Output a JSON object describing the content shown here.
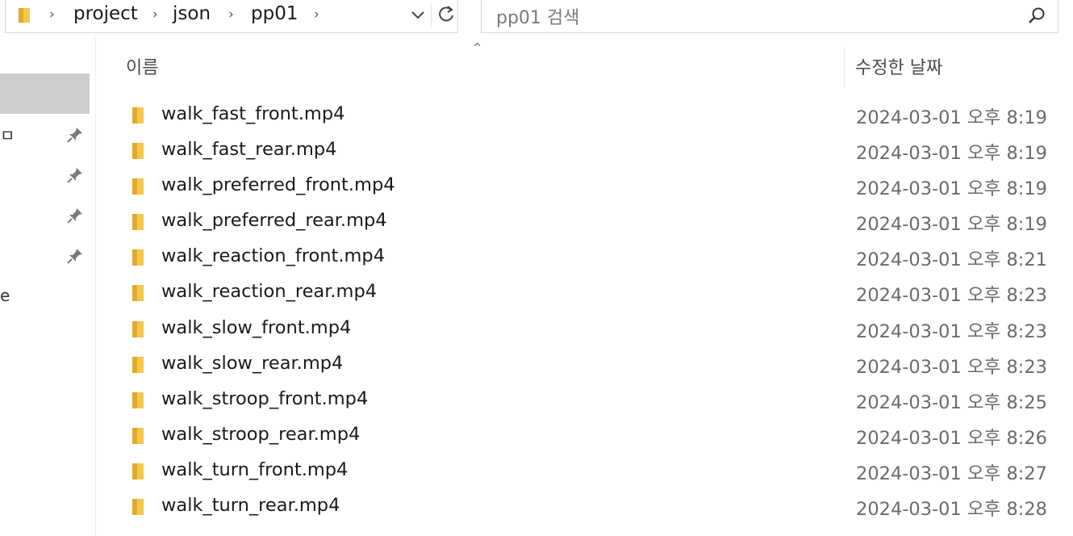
{
  "address_bar": {
    "breadcrumbs": [
      "project",
      "json",
      "pp01"
    ],
    "folder_icon": "folder-icon",
    "dropdown_icon": "chevron-down-icon",
    "refresh_icon": "refresh-icon"
  },
  "search": {
    "placeholder": "pp01 검색",
    "icon": "search-icon"
  },
  "columns": {
    "name": "이름",
    "date_modified": "수정한 날짜"
  },
  "nav_pane": {
    "fragments": [
      "ㅁ",
      "e"
    ],
    "pin_icons": 4
  },
  "files": [
    {
      "name": "walk_fast_front.mp4",
      "date": "2024-03-01 오후 8:19"
    },
    {
      "name": "walk_fast_rear.mp4",
      "date": "2024-03-01 오후 8:19"
    },
    {
      "name": "walk_preferred_front.mp4",
      "date": "2024-03-01 오후 8:19"
    },
    {
      "name": "walk_preferred_rear.mp4",
      "date": "2024-03-01 오후 8:19"
    },
    {
      "name": "walk_reaction_front.mp4",
      "date": "2024-03-01 오후 8:21"
    },
    {
      "name": "walk_reaction_rear.mp4",
      "date": "2024-03-01 오후 8:23"
    },
    {
      "name": "walk_slow_front.mp4",
      "date": "2024-03-01 오후 8:23"
    },
    {
      "name": "walk_slow_rear.mp4",
      "date": "2024-03-01 오후 8:23"
    },
    {
      "name": "walk_stroop_front.mp4",
      "date": "2024-03-01 오후 8:25"
    },
    {
      "name": "walk_stroop_rear.mp4",
      "date": "2024-03-01 오후 8:26"
    },
    {
      "name": "walk_turn_front.mp4",
      "date": "2024-03-01 오후 8:27"
    },
    {
      "name": "walk_turn_rear.mp4",
      "date": "2024-03-01 오후 8:28"
    }
  ],
  "colors": {
    "folder": "#f2c94c",
    "selection": "#cdcdcd",
    "date_text": "#6a6a6a"
  }
}
